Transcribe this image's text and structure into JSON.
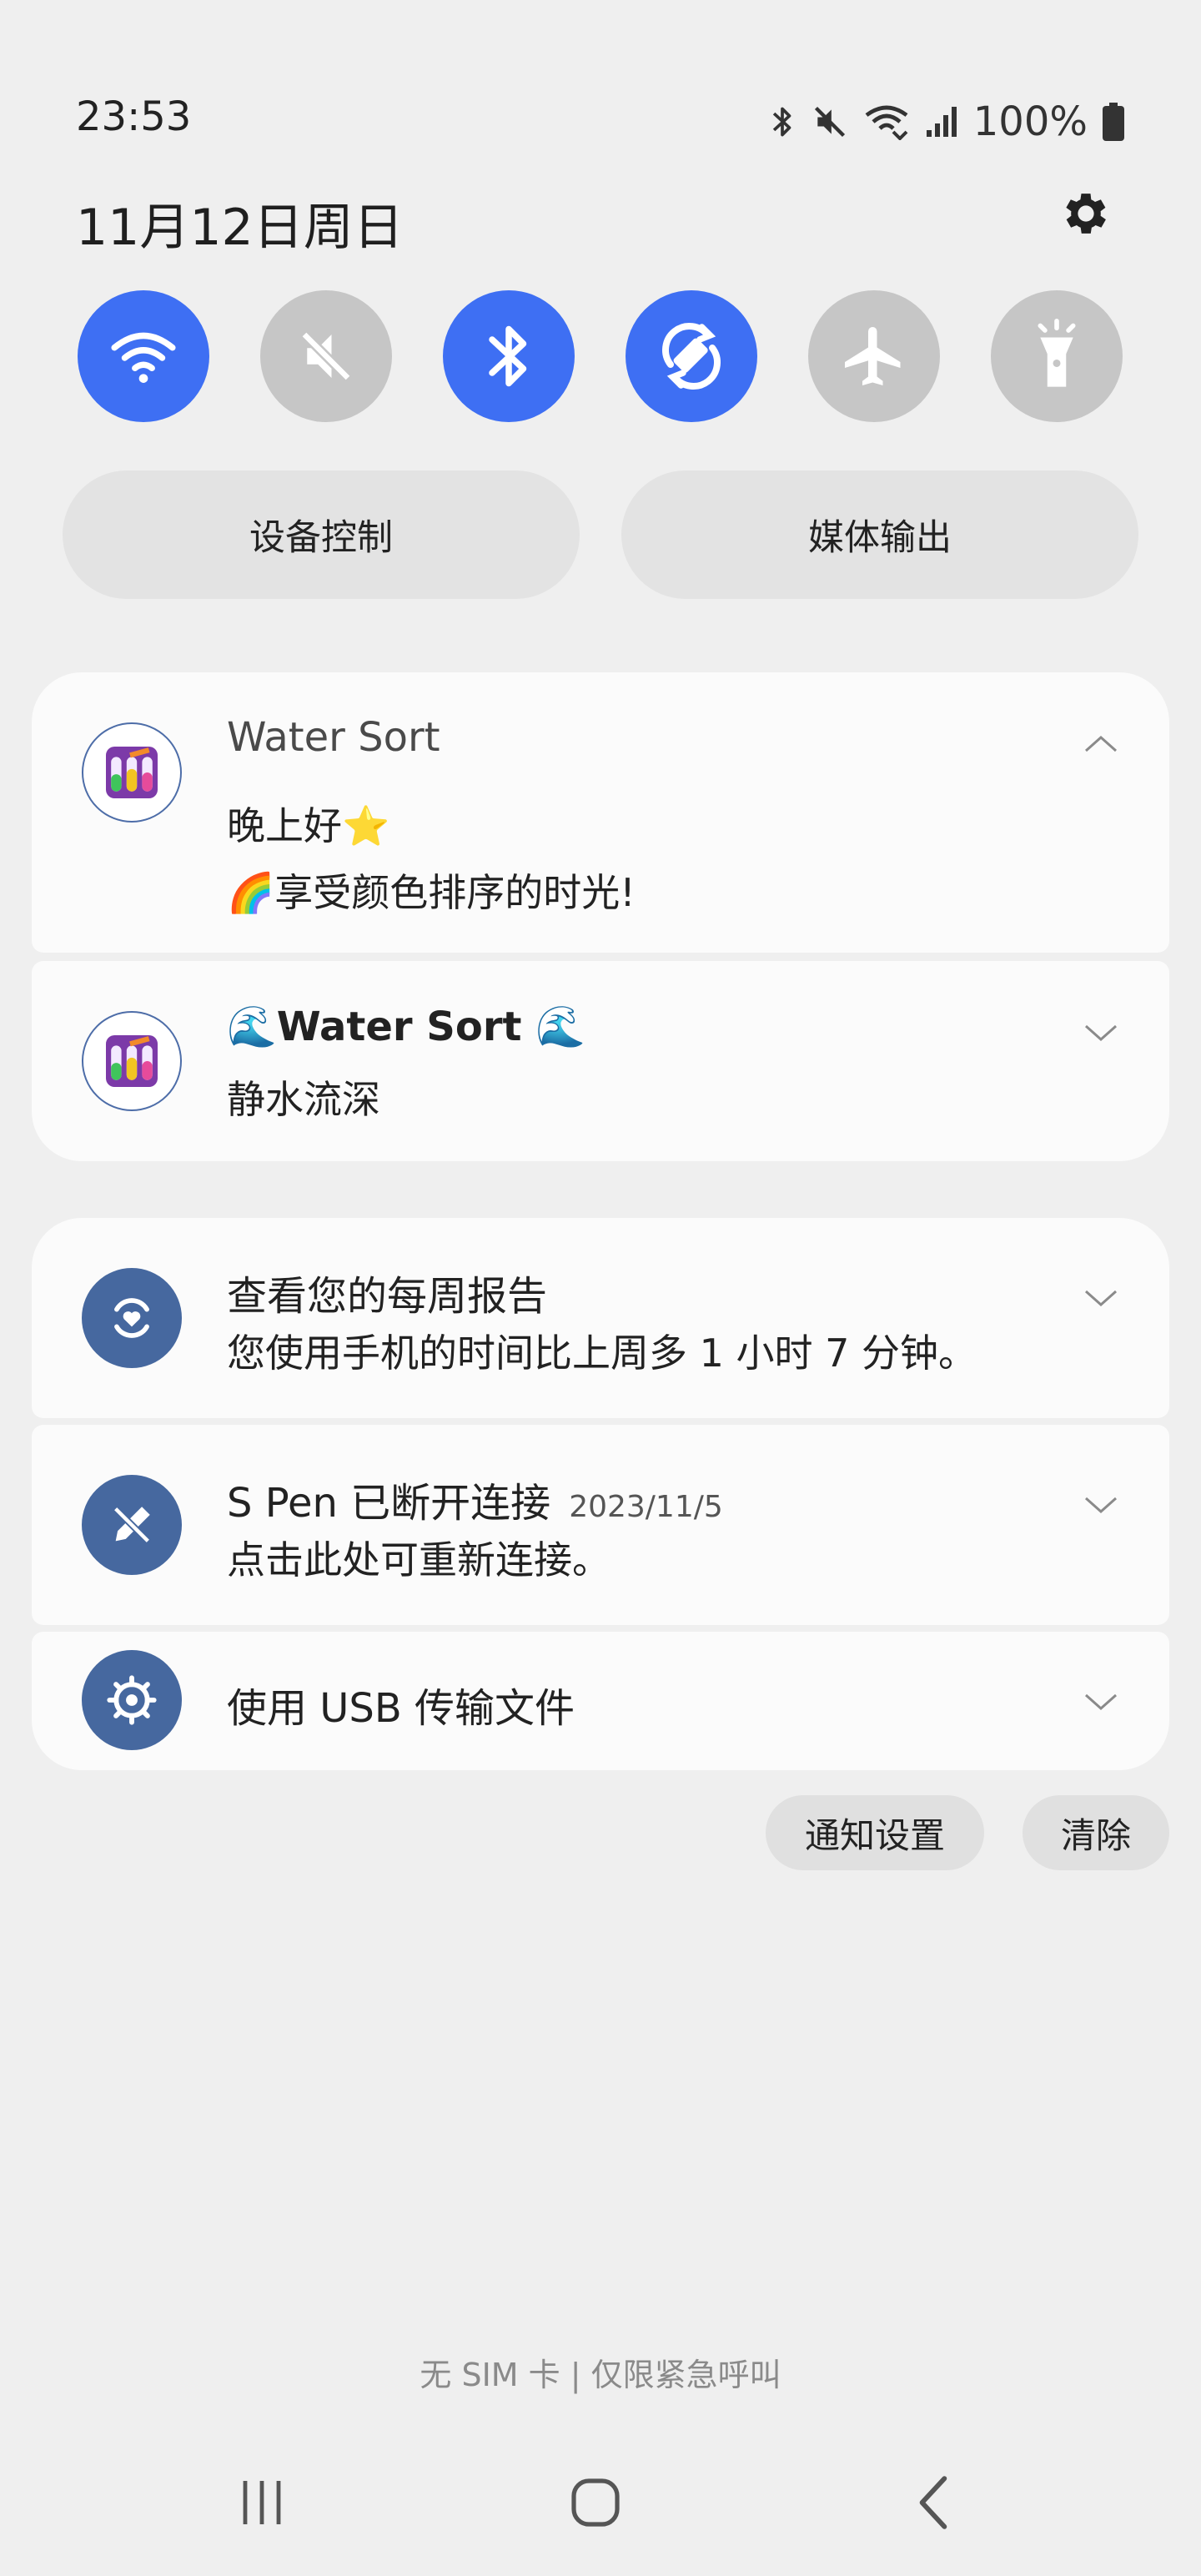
{
  "status_bar": {
    "time": "23:53",
    "battery": "100%"
  },
  "date": "11月12日周日",
  "quick_toggles": [
    {
      "name": "wifi",
      "state": "on"
    },
    {
      "name": "sound-mute",
      "state": "off"
    },
    {
      "name": "bluetooth",
      "state": "on"
    },
    {
      "name": "auto-rotate",
      "state": "on"
    },
    {
      "name": "airplane-mode",
      "state": "off"
    },
    {
      "name": "flashlight",
      "state": "off"
    }
  ],
  "buttons": {
    "device_control": "设备控制",
    "media_output": "媒体输出"
  },
  "notifications": {
    "water_sort_1": {
      "app": "Water Sort",
      "line1": "晚上好⭐",
      "line2": "🌈享受颜色排序的时光!"
    },
    "water_sort_2": {
      "title": "🌊Water Sort 🌊",
      "text": "静水流深"
    },
    "weekly_report": {
      "title": "查看您的每周报告",
      "text": "您使用手机的时间比上周多 1 小时 7 分钟。"
    },
    "spen": {
      "title": "S Pen 已断开连接",
      "date": "2023/11/5",
      "text": "点击此处可重新连接。"
    },
    "usb": {
      "title": "使用 USB 传输文件"
    }
  },
  "actions": {
    "notification_settings": "通知设置",
    "clear": "清除"
  },
  "carrier_text": "无 SIM 卡 | 仅限紧急呼叫",
  "colors": {
    "accent": "#3e6ff3",
    "toggle_off": "#c6c6c6",
    "icon_circle": "#46689f"
  }
}
